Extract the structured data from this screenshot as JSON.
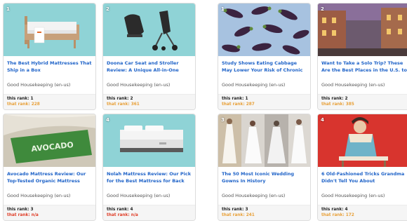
{
  "cards": [
    {
      "rank": "1",
      "title": "The Best Hybrid Mattresses That Ship in a Box",
      "source": "Good Housekeeping (en-us)",
      "this_rank": "this rank: 1",
      "that_rank": "that rank: 228",
      "that_color": "#e8a13a"
    },
    {
      "rank": "2",
      "title": "Doona Car Seat and Stroller Review: A Unique All-in-One System",
      "source": "Good Housekeeping (en-us)",
      "this_rank": "this rank: 2",
      "that_rank": "that rank: 361",
      "that_color": "#e8a13a"
    },
    {
      "rank": "1",
      "title": "Study Shows Eating Cabbage May Lower Your Risk of Chronic Diseases",
      "source": "Good Housekeeping (en-us)",
      "this_rank": "this rank: 1",
      "that_rank": "that rank: 287",
      "that_color": "#e8a13a"
    },
    {
      "rank": "2",
      "title": "Want to Take a Solo Trip? These Are the Best Places in the U.S. to Visit",
      "source": "Good Housekeeping (en-us)",
      "this_rank": "this rank: 2",
      "that_rank": "that rank: 385",
      "that_color": "#e8a13a"
    },
    {
      "rank": "",
      "title": "Avocado Mattress Review: Our Top-Tested Organic Mattress",
      "source": "Good Housekeeping (en-us)",
      "this_rank": "this rank: 3",
      "that_rank": "that rank: n/a",
      "that_color": "#e0402a",
      "thumb_text": "AVOCADO"
    },
    {
      "rank": "4",
      "title": "Nolah Mattress Review: Our Pick for the Best Mattress for Back Pain",
      "source": "Good Housekeeping (en-us)",
      "this_rank": "this rank: 4",
      "that_rank": "that rank: n/a",
      "that_color": "#e0402a"
    },
    {
      "rank": "3",
      "title": "The 50 Most Iconic Wedding Gowns In History",
      "source": "Good Housekeeping (en-us)",
      "this_rank": "this rank: 3",
      "that_rank": "that rank: 241",
      "that_color": "#e8a13a"
    },
    {
      "rank": "4",
      "title": "6 Old-Fashioned Tricks Grandma Didn't Tell You About",
      "source": "Good Housekeeping (en-us)",
      "this_rank": "this rank: 4",
      "that_rank": "that rank: 172",
      "that_color": "#e8a13a"
    }
  ]
}
